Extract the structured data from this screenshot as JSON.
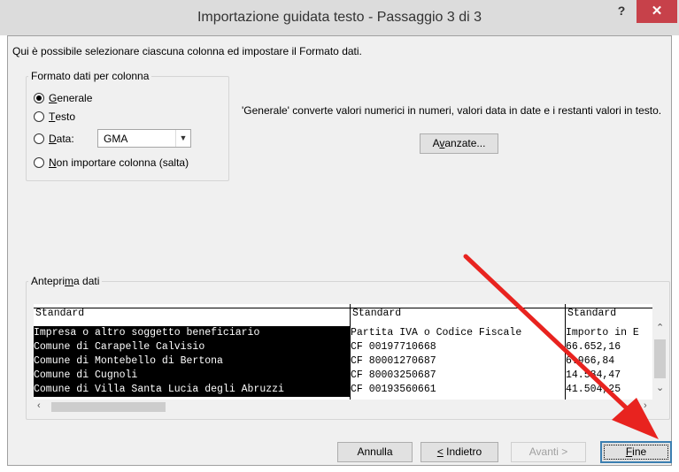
{
  "window": {
    "title": "Importazione guidata testo - Passaggio 3 di 3",
    "help_label": "?",
    "close_label": "✕"
  },
  "intro_text": "Qui è possibile selezionare ciascuna colonna ed impostare il Formato dati.",
  "column_format": {
    "legend": "Formato dati per colonna",
    "options": [
      {
        "key": "G",
        "rest": "enerale",
        "checked": true
      },
      {
        "key": "T",
        "rest": "esto",
        "checked": false
      },
      {
        "key": "D",
        "rest": "ata:",
        "checked": false
      },
      {
        "key": "N",
        "rest": "on importare colonna (salta)",
        "checked": false
      }
    ],
    "date_format": "GMA"
  },
  "description": "'Generale' converte valori numerici in numeri, valori data in date e i restanti valori in testo.",
  "advanced_button": {
    "pre": "A",
    "key": "v",
    "post": "anzate..."
  },
  "preview": {
    "legend_pre": "Antepri",
    "legend_key": "m",
    "legend_post": "a dati",
    "columns": [
      {
        "header": "Standard",
        "cells": [
          "Impresa o altro soggetto beneficiario",
          "Comune di Carapelle Calvisio",
          "Comune di Montebello di Bertona",
          "Comune di Cugnoli",
          "Comune di Villa Santa Lucia degli Abruzzi"
        ]
      },
      {
        "header": "Standard",
        "cells": [
          "Partita IVA o Codice Fiscale",
          "CF 00197710668",
          "CF 80001270687",
          "CF 80003250687",
          "CF 00193560661"
        ]
      },
      {
        "header": "Standard",
        "cells": [
          "Importo in E",
          "66.652,16",
          "6.966,84",
          "14.584,47",
          "41.504,25"
        ]
      }
    ]
  },
  "buttons": {
    "cancel": "Annulla",
    "back_key": "<",
    "back_rest": " Indietro",
    "next": "Avanti >",
    "finish_key": "F",
    "finish_rest": "ine"
  },
  "colors": {
    "selected_column_bg": "#000000",
    "annotation_arrow": "#e8231f",
    "default_button_border": "#3c7fb1",
    "close_button": "#c7414a"
  },
  "icons": [
    "help-icon",
    "close-icon",
    "chevron-down-icon",
    "scroll-up-icon",
    "scroll-down-icon",
    "scroll-left-icon",
    "scroll-right-icon",
    "red-arrow-annotation"
  ]
}
